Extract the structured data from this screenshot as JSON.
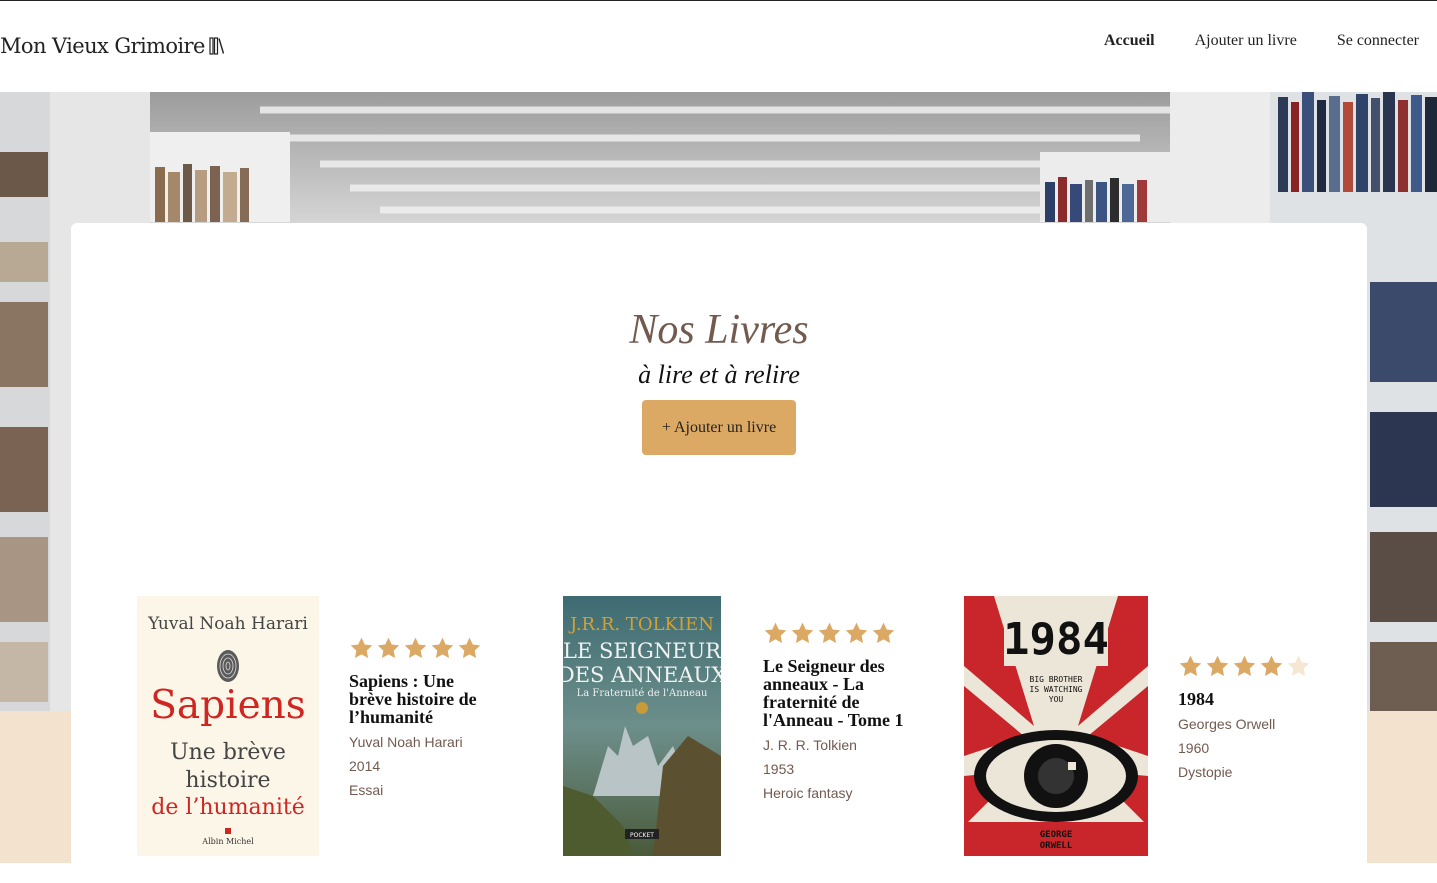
{
  "header": {
    "logo_text": "Mon Vieux Grimoire",
    "nav": [
      {
        "label": "Accueil",
        "active": true
      },
      {
        "label": "Ajouter un livre",
        "active": false
      },
      {
        "label": "Se connecter",
        "active": false
      }
    ]
  },
  "main": {
    "title": "Nos Livres",
    "subtitle": "à lire et à relire",
    "add_button": "+ Ajouter un livre"
  },
  "books": [
    {
      "title": "Sapiens : Une brève histoire de l’humanité",
      "author": "Yuval Noah Harari",
      "year": "2014",
      "genre": "Essai",
      "rating": 5,
      "cover": {
        "top": "Yuval Noah Harari",
        "big": "Sapiens",
        "l1": "Une brève",
        "l2": "histoire",
        "l3": "de l’humanité",
        "publisher": "Albin Michel"
      }
    },
    {
      "title": "Le Seigneur des anneaux - La fraternité de l'Anneau - Tome 1",
      "author": "J. R. R. Tolkien",
      "year": "1953",
      "genre": "Heroic fantasy",
      "rating": 5,
      "cover": {
        "author": "J.R.R. TOLKIEN",
        "l1": "LE SEIGNEUR",
        "l2": "DES ANNEAUX",
        "l3": "La Fraternité de l'Anneau",
        "publisher": "POCKET"
      }
    },
    {
      "title": "1984",
      "author": "Georges Orwell",
      "year": "1960",
      "genre": "Dystopie",
      "rating": 4,
      "cover": {
        "big": "1984",
        "l1": "BIG BROTHER",
        "l2": "IS WATCHING",
        "l3": "YOU",
        "a1": "GEORGE",
        "a2": "ORWELL"
      }
    }
  ],
  "colors": {
    "accent": "#dca965",
    "title": "#725a4f",
    "beige_band": "#f3e2cd",
    "star_filled": "#dca965",
    "star_empty": "#f6e7d2"
  }
}
